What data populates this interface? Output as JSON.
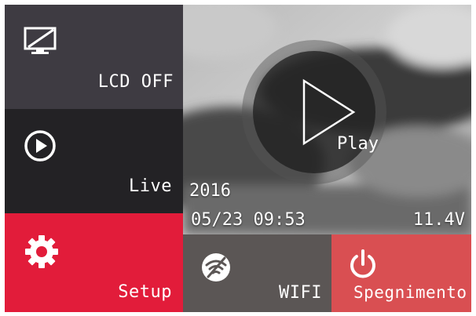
{
  "colors": {
    "lcd_tile": "#3e3b42",
    "live_tile": "#232225",
    "setup_tile": "#e21c3a",
    "wifi_tile": "#5b5655",
    "power_tile": "#d94f52",
    "text": "#ffffff"
  },
  "menu": {
    "lcd_off": {
      "label": "LCD OFF",
      "icon": "monitor-off-icon"
    },
    "live": {
      "label": "Live",
      "icon": "play-circle-icon"
    },
    "setup": {
      "label": "Setup",
      "icon": "gear-icon"
    },
    "wifi": {
      "label": "WIFI",
      "icon": "wifi-off-icon"
    },
    "power": {
      "label": "Spegnimento",
      "icon": "power-icon"
    }
  },
  "preview": {
    "play_label": "Play",
    "year": "2016",
    "datetime": "05/23 09:53",
    "voltage": "11.4V"
  }
}
